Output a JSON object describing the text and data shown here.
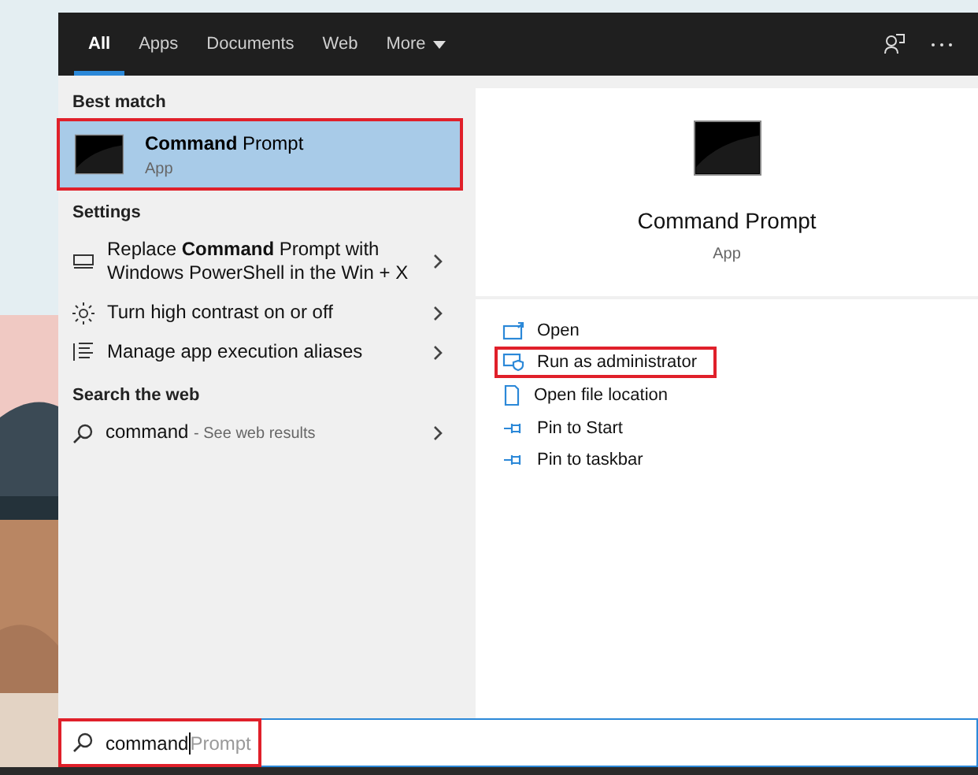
{
  "tabs": [
    {
      "label": "All",
      "selected": true,
      "dropdown": false
    },
    {
      "label": "Apps",
      "selected": false,
      "dropdown": false
    },
    {
      "label": "Documents",
      "selected": false,
      "dropdown": false
    },
    {
      "label": "Web",
      "selected": false,
      "dropdown": false
    },
    {
      "label": "More",
      "selected": false,
      "dropdown": true
    }
  ],
  "best_match": {
    "heading": "Best match",
    "title": "**Command** Prompt",
    "subtitle": "App",
    "selected": true,
    "highlighted": true
  },
  "settings": {
    "heading": "Settings",
    "items": [
      {
        "kind": "display",
        "label": "Replace **Command** Prompt with Windows PowerShell in the Win + X"
      },
      {
        "kind": "brightness",
        "label": "Turn high contrast on or off"
      },
      {
        "kind": "list",
        "label": "Manage app execution aliases"
      }
    ]
  },
  "web": {
    "heading": "Search the web",
    "query": "command",
    "hint": "- See web results"
  },
  "detail": {
    "title": "Command Prompt",
    "subtitle": "App",
    "actions": [
      {
        "kind": "open",
        "label": "Open",
        "highlighted": false
      },
      {
        "kind": "admin",
        "label": "Run as administrator",
        "highlighted": true
      },
      {
        "kind": "folder",
        "label": "Open file location",
        "highlighted": false
      },
      {
        "kind": "pin",
        "label": "Pin to Start",
        "highlighted": false
      },
      {
        "kind": "pin",
        "label": "Pin to taskbar",
        "highlighted": false
      }
    ]
  },
  "search": {
    "value": "command",
    "suggestion": "Prompt",
    "highlighted": true
  }
}
